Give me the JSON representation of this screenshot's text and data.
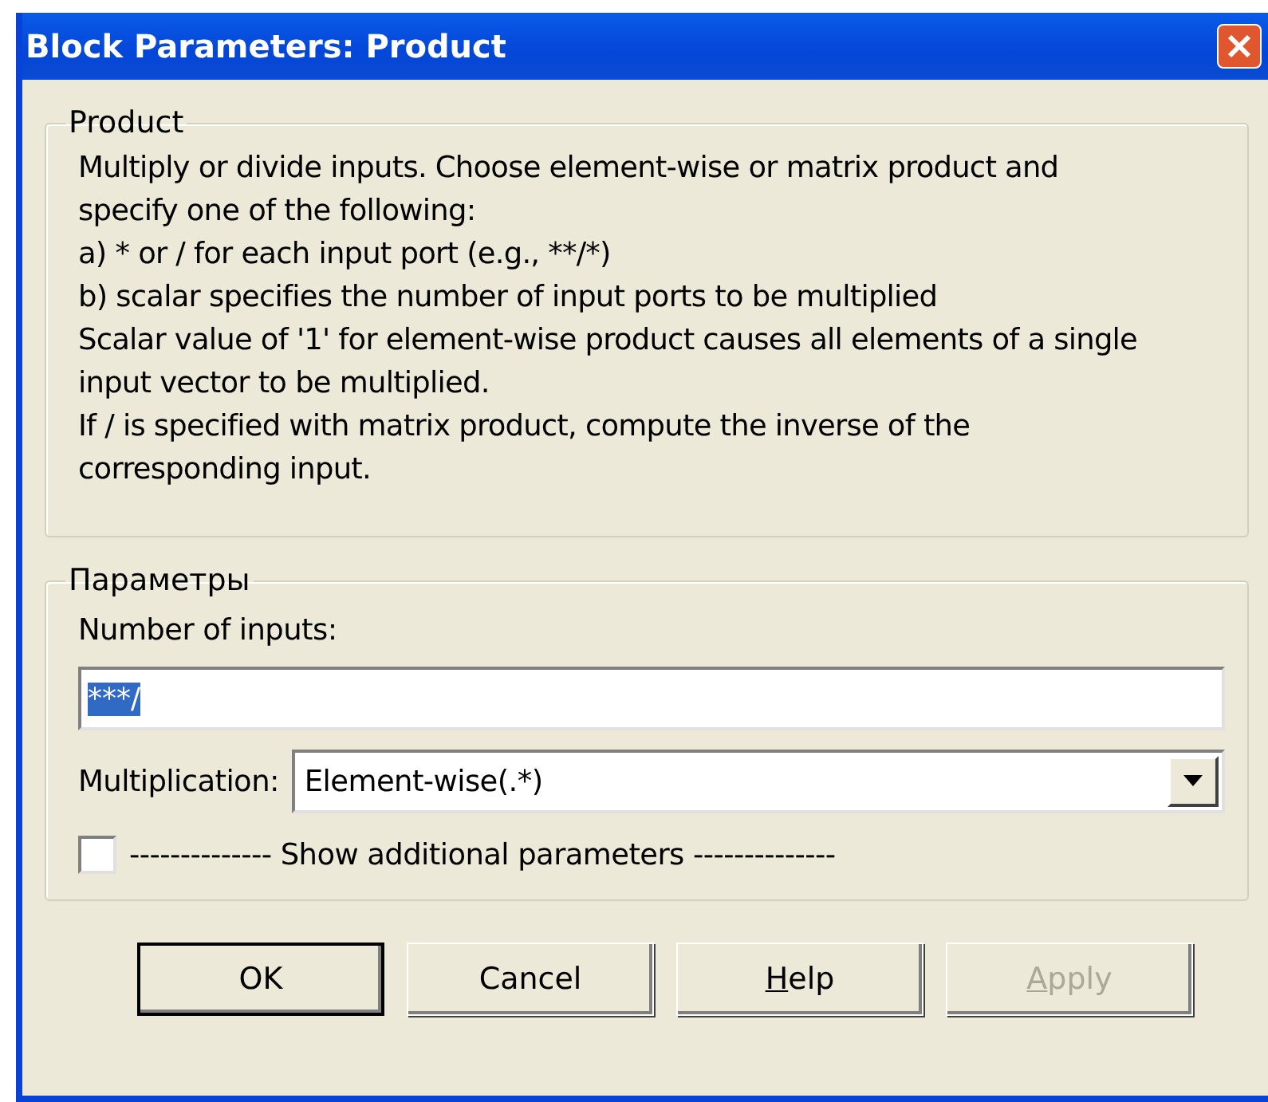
{
  "window": {
    "title": "Block Parameters: Product"
  },
  "description": {
    "legend": "Product",
    "lines": [
      "Multiply or divide inputs.  Choose element-wise or matrix product and",
      "specify one of the following:",
      "a) * or / for each input port (e.g., **/*)",
      "b) scalar specifies the number of input ports to be multiplied",
      "Scalar value of '1' for element-wise product causes all elements of a single",
      "input vector to be multiplied.",
      "If / is specified with matrix product, compute the inverse of the",
      "corresponding input."
    ]
  },
  "parameters": {
    "legend": "Параметры",
    "inputs_label": "Number of inputs:",
    "inputs_value": "***/",
    "inputs_text_selected": true,
    "multiplication_label": "Multiplication:",
    "multiplication_value": "Element-wise(.*)",
    "show_additional": {
      "label": "-------------- Show additional parameters --------------",
      "checked": false
    }
  },
  "buttons": [
    {
      "label": "OK",
      "default": true,
      "disabled": false
    },
    {
      "label": "Cancel",
      "default": false,
      "disabled": false
    },
    {
      "access_key": "H",
      "label": "elp",
      "default": false,
      "disabled": false
    },
    {
      "access_key": "A",
      "label": "pply",
      "default": false,
      "disabled": true
    }
  ]
}
